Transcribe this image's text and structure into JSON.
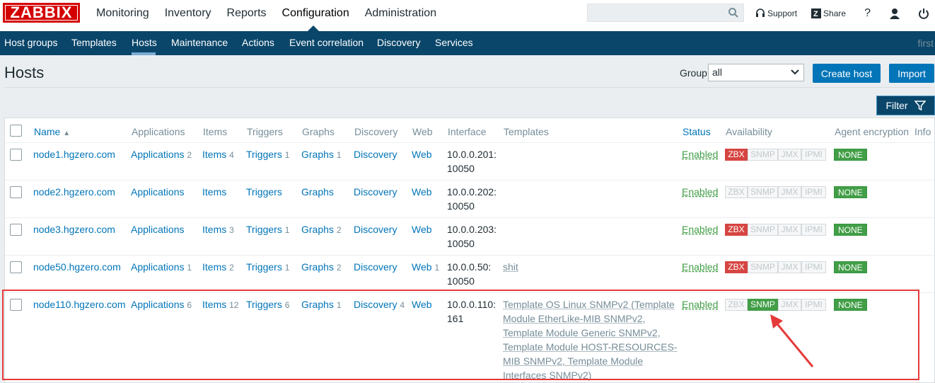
{
  "logo": "ZABBIX",
  "main_menu": [
    "Monitoring",
    "Inventory",
    "Reports",
    "Configuration",
    "Administration"
  ],
  "top_links": {
    "support": "Support",
    "share": "Share",
    "help": "?"
  },
  "sub_menu": [
    "Host groups",
    "Templates",
    "Hosts",
    "Maintenance",
    "Actions",
    "Event correlation",
    "Discovery",
    "Services"
  ],
  "user_text": "first",
  "page_title": "Hosts",
  "group": {
    "label": "Group",
    "value": "all"
  },
  "buttons": {
    "create": "Create host",
    "import": "Import",
    "filter": "Filter"
  },
  "columns": [
    "Name",
    "Applications",
    "Items",
    "Triggers",
    "Graphs",
    "Discovery",
    "Web",
    "Interface",
    "Templates",
    "Status",
    "Availability",
    "Agent encryption",
    "Info"
  ],
  "sort_indicator": "▲",
  "availability_labels": [
    "ZBX",
    "SNMP",
    "JMX",
    "IPMI"
  ],
  "colors": {
    "header": "#0a466a",
    "link": "#0275b8",
    "enabled": "#429e47",
    "zbx_error": "#d64541",
    "annotation": "#e53a3a"
  },
  "rows": [
    {
      "name": "node1.hgzero.com",
      "apps": "Applications",
      "apps_n": "2",
      "items": "Items",
      "items_n": "4",
      "triggers": "Triggers",
      "triggers_n": "1",
      "graphs": "Graphs",
      "graphs_n": "1",
      "discovery": "Discovery",
      "discovery_n": "",
      "web": "Web",
      "web_n": "",
      "iface1": "10.0.0.201:",
      "iface2": "10050",
      "status": "Enabled",
      "enc": "NONE"
    },
    {
      "name": "node2.hgzero.com",
      "apps": "Applications",
      "apps_n": "",
      "items": "Items",
      "items_n": "",
      "triggers": "Triggers",
      "triggers_n": "",
      "graphs": "Graphs",
      "graphs_n": "",
      "discovery": "Discovery",
      "discovery_n": "",
      "web": "Web",
      "web_n": "",
      "iface1": "10.0.0.202:",
      "iface2": "10050",
      "status": "Enabled",
      "enc": "NONE"
    },
    {
      "name": "node3.hgzero.com",
      "apps": "Applications",
      "apps_n": "",
      "items": "Items",
      "items_n": "3",
      "triggers": "Triggers",
      "triggers_n": "1",
      "graphs": "Graphs",
      "graphs_n": "2",
      "discovery": "Discovery",
      "discovery_n": "",
      "web": "Web",
      "web_n": "",
      "iface1": "10.0.0.203:",
      "iface2": "10050",
      "status": "Enabled",
      "enc": "NONE"
    },
    {
      "name": "node50.hgzero.com",
      "apps": "Applications",
      "apps_n": "1",
      "items": "Items",
      "items_n": "2",
      "triggers": "Triggers",
      "triggers_n": "1",
      "graphs": "Graphs",
      "graphs_n": "2",
      "discovery": "Discovery",
      "discovery_n": "",
      "web": "Web",
      "web_n": "1",
      "iface1": "10.0.0.50:",
      "iface2": "10050",
      "template": "shit",
      "status": "Enabled",
      "enc": "NONE"
    },
    {
      "name": "node110.hgzero.com",
      "apps": "Applications",
      "apps_n": "6",
      "items": "Items",
      "items_n": "12",
      "triggers": "Triggers",
      "triggers_n": "6",
      "graphs": "Graphs",
      "graphs_n": "1",
      "discovery": "Discovery",
      "discovery_n": "4",
      "web": "Web",
      "web_n": "",
      "iface1": "10.0.0.110:",
      "iface2": "161",
      "status": "Enabled",
      "enc": "NONE",
      "tpl_lines": [
        "Template OS Linux SNMPv2 (Template",
        "Module EtherLike-MIB SNMPv2,",
        "Template Module Generic SNMPv2,",
        "Template Module HOST-RESOURCES-",
        "MIB SNMPv2, Template Module",
        "Interfaces SNMPv2)"
      ]
    }
  ]
}
